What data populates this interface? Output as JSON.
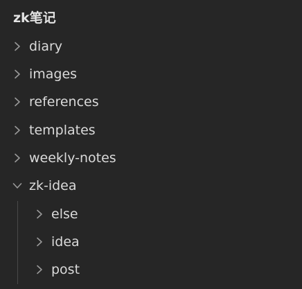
{
  "explorer": {
    "vault_title": "zk笔记",
    "folders": [
      {
        "label": "diary",
        "expanded": false,
        "depth": 0,
        "icon": "chevron-right-icon"
      },
      {
        "label": "images",
        "expanded": false,
        "depth": 0,
        "icon": "chevron-right-icon"
      },
      {
        "label": "references",
        "expanded": false,
        "depth": 0,
        "icon": "chevron-right-icon"
      },
      {
        "label": "templates",
        "expanded": false,
        "depth": 0,
        "icon": "chevron-right-icon"
      },
      {
        "label": "weekly-notes",
        "expanded": false,
        "depth": 0,
        "icon": "chevron-right-icon"
      },
      {
        "label": "zk-idea",
        "expanded": true,
        "depth": 0,
        "icon": "chevron-down-icon"
      },
      {
        "label": "else",
        "expanded": false,
        "depth": 1,
        "icon": "chevron-right-icon"
      },
      {
        "label": "idea",
        "expanded": false,
        "depth": 1,
        "icon": "chevron-right-icon"
      },
      {
        "label": "post",
        "expanded": false,
        "depth": 1,
        "icon": "chevron-right-icon"
      }
    ]
  },
  "colors": {
    "background": "#262626",
    "text": "#dadada",
    "chevron": "#9a9a9a",
    "indent_guide": "#4a4a4a"
  }
}
